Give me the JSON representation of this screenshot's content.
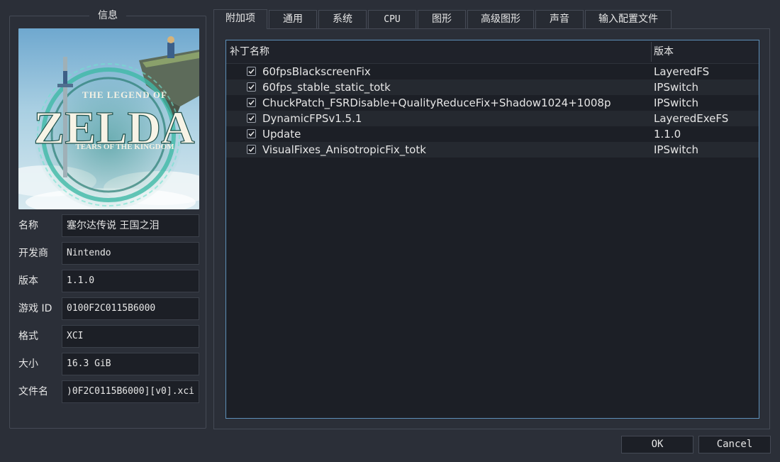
{
  "info": {
    "title": "信息",
    "cover": {
      "alt": "Zelda: Tears of the Kingdom cover art",
      "logo_top": "THE LEGEND OF",
      "logo_main": "ZELDA",
      "logo_sub": "TEARS OF THE KINGDOM"
    },
    "fields": [
      {
        "label": "名称",
        "value": "塞尔达传说 王国之泪"
      },
      {
        "label": "开发商",
        "value": "Nintendo"
      },
      {
        "label": "版本",
        "value": "1.1.0"
      },
      {
        "label": "游戏 ID",
        "value": "0100F2C0115B6000"
      },
      {
        "label": "格式",
        "value": "XCI"
      },
      {
        "label": "大小",
        "value": "16.3 GiB"
      },
      {
        "label": "文件名",
        "value": ")0F2C0115B6000][v0].xci"
      }
    ]
  },
  "tabs": [
    "附加项",
    "通用",
    "系统",
    "CPU",
    "图形",
    "高级图形",
    "声音",
    "输入配置文件"
  ],
  "active_tab_index": 0,
  "patch_list": {
    "columns": {
      "name": "补丁名称",
      "version": "版本"
    },
    "rows": [
      {
        "name": "60fpsBlackscreenFix",
        "version": "LayeredFS",
        "checked": true
      },
      {
        "name": "60fps_stable_static_totk",
        "version": "IPSwitch",
        "checked": true
      },
      {
        "name": "ChuckPatch_FSRDisable+QualityReduceFix+Shadow1024+1008p",
        "version": "IPSwitch",
        "checked": true
      },
      {
        "name": "DynamicFPSv1.5.1",
        "version": "LayeredExeFS",
        "checked": true
      },
      {
        "name": "Update",
        "version": "1.1.0",
        "checked": true
      },
      {
        "name": "VisualFixes_AnisotropicFix_totk",
        "version": "IPSwitch",
        "checked": true
      }
    ]
  },
  "buttons": {
    "ok": "OK",
    "cancel": "Cancel"
  },
  "colors": {
    "background": "#2b2f38",
    "list_background": "#1c1f26",
    "list_focus_border": "#5d8fb8",
    "cover_teal": "#4fe0c8"
  },
  "icons": {
    "checkbox": "checkmark-icon"
  }
}
